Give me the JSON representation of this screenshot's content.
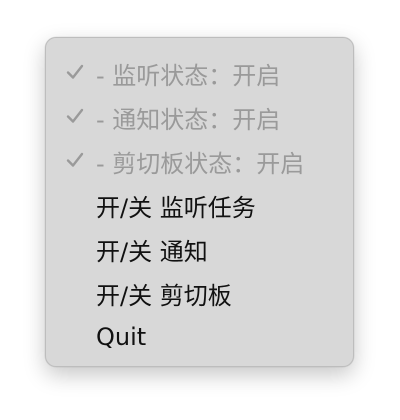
{
  "menu": {
    "items": [
      {
        "label": "- 监听状态：开启",
        "checked": true,
        "enabled": false
      },
      {
        "label": "- 通知状态：开启",
        "checked": true,
        "enabled": false
      },
      {
        "label": "- 剪切板状态：开启",
        "checked": true,
        "enabled": false
      },
      {
        "label": "开/关 监听任务",
        "checked": false,
        "enabled": true
      },
      {
        "label": "开/关 通知",
        "checked": false,
        "enabled": true
      },
      {
        "label": "开/关 剪切板",
        "checked": false,
        "enabled": true
      },
      {
        "label": "Quit",
        "checked": false,
        "enabled": true
      }
    ]
  },
  "colors": {
    "menu_background": "#d8d8d8",
    "enabled_text": "#111111",
    "disabled_text": "#9a9a9a"
  }
}
